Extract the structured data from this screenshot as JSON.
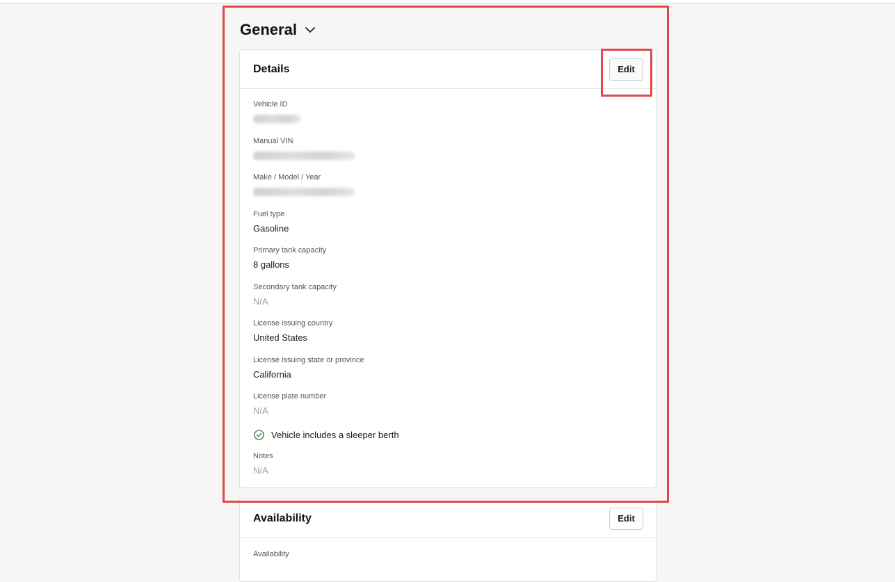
{
  "section": {
    "title": "General",
    "toggle_icon": "chevron-down-icon"
  },
  "details": {
    "title": "Details",
    "edit_label": "Edit",
    "fields": {
      "vehicle_id": {
        "label": "Vehicle ID",
        "value": ""
      },
      "manual_vin": {
        "label": "Manual VIN",
        "value": ""
      },
      "make_model_year": {
        "label": "Make / Model / Year",
        "value": ""
      },
      "fuel_type": {
        "label": "Fuel type",
        "value": "Gasoline"
      },
      "primary_tank": {
        "label": "Primary tank capacity",
        "value": "8 gallons"
      },
      "secondary_tank": {
        "label": "Secondary tank capacity",
        "value": "N/A"
      },
      "license_country": {
        "label": "License issuing country",
        "value": "United States"
      },
      "license_state": {
        "label": "License issuing state or province",
        "value": "California"
      },
      "license_plate": {
        "label": "License plate number",
        "value": "N/A"
      }
    },
    "sleeper_berth": {
      "text": "Vehicle includes a sleeper berth",
      "icon": "check-circle-icon",
      "checked": true
    },
    "notes": {
      "label": "Notes",
      "value": "N/A"
    }
  },
  "availability": {
    "title": "Availability",
    "edit_label": "Edit",
    "fields": {
      "availability": {
        "label": "Availability"
      }
    }
  },
  "colors": {
    "highlight": "#e04848",
    "check": "#2e7d32",
    "muted": "#a0a0a0"
  }
}
